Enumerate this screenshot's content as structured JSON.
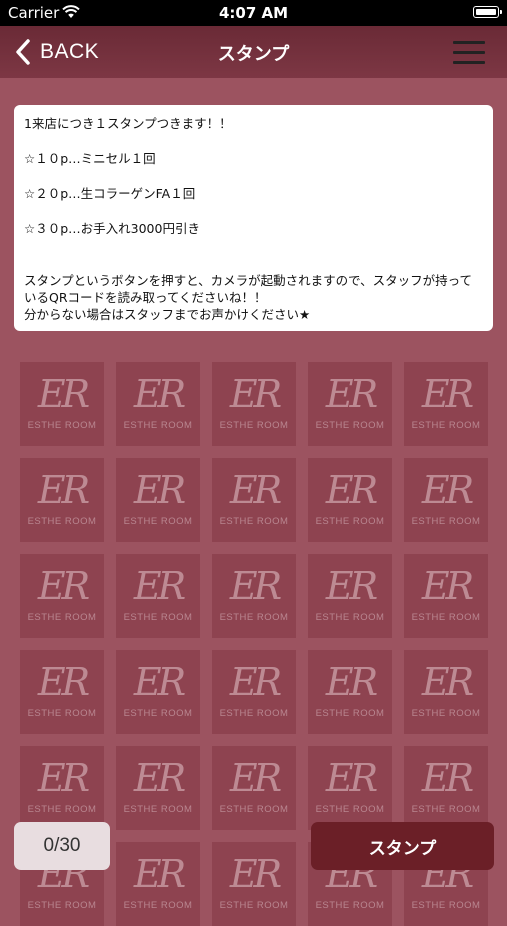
{
  "status_bar": {
    "carrier": "Carrier",
    "time": "4:07 AM"
  },
  "nav": {
    "back_label": "BACK",
    "title": "スタンプ",
    "back_icon": "chevron-left-icon",
    "menu_icon": "hamburger-menu-icon"
  },
  "info": {
    "line1": "1来店につき１スタンプつきます！！",
    "line2": "☆１０p…ミニセル１回",
    "line3": "☆２０p…生コラーゲンFA１回",
    "line4": "☆３０p…お手入れ3000円引き",
    "line5": "スタンプというボタンを押すと、カメラが起動されますので、スタッフが持っているQRコードを読み取ってくださいね！！",
    "line6": "分からない場合はスタッフまでお声かけください★"
  },
  "stamp_card": {
    "logo_mark": "ER",
    "logo_text": "ESTHE ROOM",
    "collected": 0,
    "total": 30
  },
  "counter_label": "0/30",
  "stamp_button_label": "スタンプ",
  "colors": {
    "background": "#9c5360",
    "nav_bar": "#7d3744",
    "stamp_tile": "#8e4350",
    "stamp_button": "#6b1f27",
    "counter_bg": "#e8dde0"
  }
}
